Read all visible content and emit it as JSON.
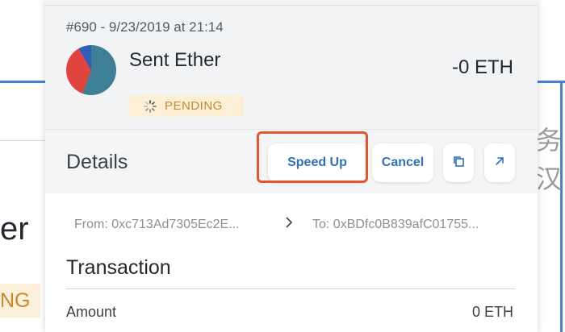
{
  "background": {
    "text_fragment": "er",
    "pending_fragment": "NG",
    "cjk_fragment": "务 汉"
  },
  "transaction": {
    "meta": "#690 - 9/23/2019 at 21:14",
    "title": "Sent Ether",
    "amount": "-0 ETH",
    "status": "PENDING"
  },
  "details": {
    "label": "Details",
    "speed_up_label": "Speed Up",
    "cancel_label": "Cancel"
  },
  "addresses": {
    "from": "From: 0xc713Ad7305Ec2E...",
    "to": "To: 0xBDfc0B839afC01755..."
  },
  "section": {
    "title": "Transaction",
    "rows": [
      {
        "label": "Amount",
        "value": "0 ETH"
      }
    ]
  },
  "colors": {
    "accent": "#2f6fbc",
    "highlight": "#e5552b",
    "pending_text": "#c68a2c",
    "pending_bg": "#fcefd6"
  },
  "icons": {
    "status": "spinner-icon",
    "copy": "copy-icon",
    "open": "external-link-icon",
    "arrow": "chevron-right-icon"
  }
}
